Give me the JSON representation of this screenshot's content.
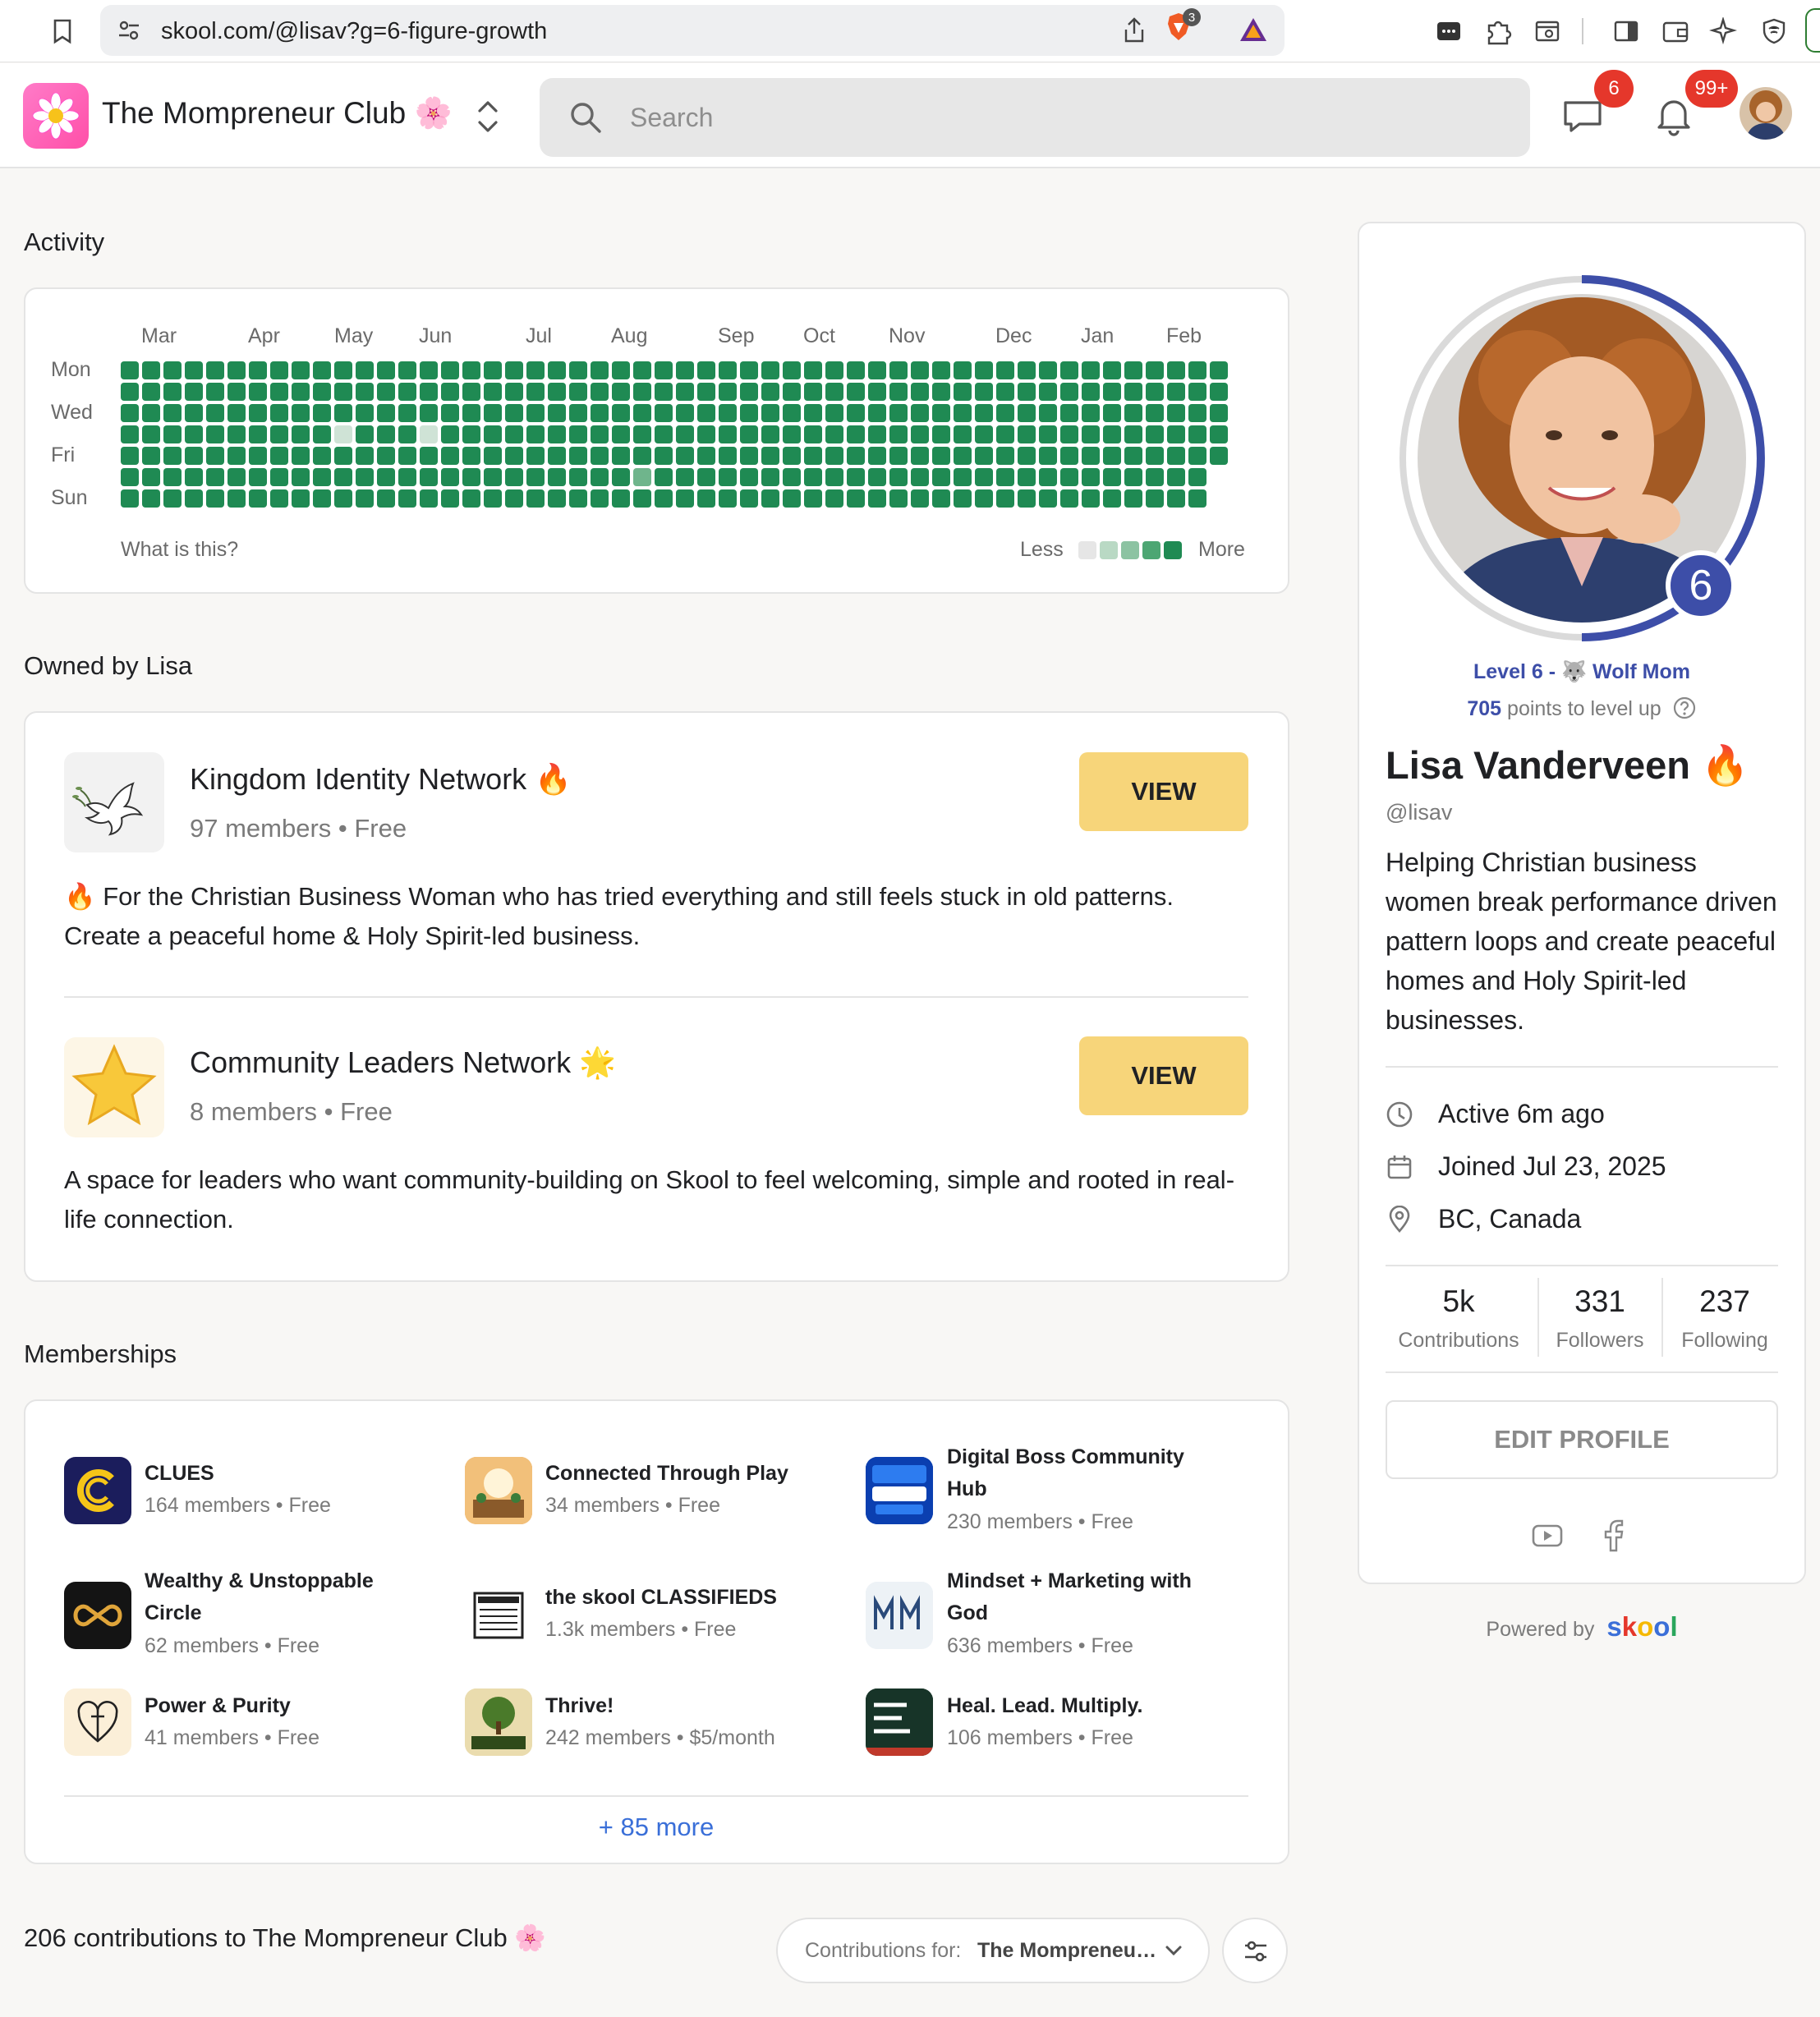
{
  "browser": {
    "url": "skool.com/@lisav?g=6-figure-growth",
    "brave_badge": "3"
  },
  "header": {
    "club_name": "The Mompreneur Club 🌸",
    "search_placeholder": "Search",
    "chat_badge": "6",
    "notif_badge": "99+"
  },
  "activity": {
    "title": "Activity",
    "months": [
      "Mar",
      "Apr",
      "May",
      "Jun",
      "Jul",
      "Aug",
      "Sep",
      "Oct",
      "Nov",
      "Dec",
      "Jan",
      "Feb"
    ],
    "days": [
      "Mon",
      "Wed",
      "Fri",
      "Sun"
    ],
    "what_is_this": "What is this?",
    "legend_less": "Less",
    "legend_more": "More",
    "colors": {
      "full": "#1f8a53",
      "light": "#cfe3d6",
      "mid": "#6fb58c"
    }
  },
  "owned": {
    "title": "Owned by Lisa",
    "groups": [
      {
        "name": "Kingdom Identity Network 🔥",
        "meta": "97 members • Free",
        "button": "VIEW",
        "desc": "🔥 For the Christian Business Woman who has tried everything and still feels stuck in old patterns. Create a peaceful home & Holy Spirit-led business."
      },
      {
        "name": "Community Leaders Network 🌟",
        "meta": "8 members • Free",
        "button": "VIEW",
        "desc": "A space for leaders who want community-building on Skool to feel welcoming, simple and rooted in real-life connection."
      }
    ]
  },
  "memberships": {
    "title": "Memberships",
    "items": [
      {
        "name": "CLUES",
        "meta": "164 members • Free"
      },
      {
        "name": "Connected Through Play",
        "meta": "34 members • Free"
      },
      {
        "name": "Digital Boss Community Hub",
        "meta": "230 members • Free"
      },
      {
        "name": "Wealthy & Unstoppable Circle",
        "meta": "62 members • Free"
      },
      {
        "name": "the skool CLASSIFIEDS",
        "meta": "1.3k members • Free"
      },
      {
        "name": "Mindset + Marketing with God",
        "meta": "636 members • Free"
      },
      {
        "name": "Power & Purity",
        "meta": "41 members • Free"
      },
      {
        "name": "Thrive!",
        "meta": "242 members • $5/month"
      },
      {
        "name": "Heal. Lead. Multiply.",
        "meta": "106 members • Free"
      }
    ],
    "more": "+ 85 more"
  },
  "contributions": {
    "title": "206 contributions to The Mompreneur Club 🌸",
    "select_prefix": "Contributions for: ",
    "select_value": "The Mompreneur Club",
    "select_value_visible": "The Mompreneu…"
  },
  "profile": {
    "level_number": "6",
    "level_text": "Level 6 - 🐺 Wolf Mom",
    "points_value": "705",
    "points_text": " points to level up",
    "name": "Lisa Vanderveen 🔥",
    "handle": "@lisav",
    "bio": "Helping Christian business women break performance driven pattern loops and create peaceful homes and Holy Spirit-led businesses.",
    "active": "Active 6m ago",
    "joined": "Joined Jul 23, 2025",
    "location": "BC, Canada",
    "stats": [
      {
        "value": "5k",
        "label": "Contributions"
      },
      {
        "value": "331",
        "label": "Followers"
      },
      {
        "value": "237",
        "label": "Following"
      }
    ],
    "edit_button": "EDIT PROFILE",
    "powered_by": "Powered by",
    "powered_brand": "skool"
  }
}
